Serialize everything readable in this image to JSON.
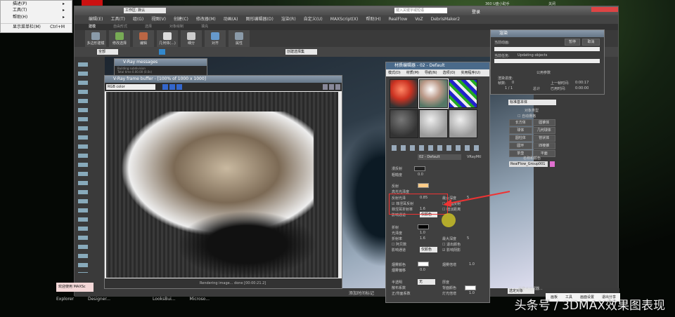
{
  "top": {
    "usb": "360 U盘小助手",
    "close": "关闭"
  },
  "context_menu": {
    "items": [
      {
        "label": "描述(P)"
      },
      {
        "label": "工具(T)"
      },
      {
        "label": "帮助(H)"
      },
      {
        "label": "显示菜单栏(M)",
        "shortcut": "Ctrl+M"
      }
    ]
  },
  "max": {
    "workspace": "工作区: 默认",
    "search_placeholder": "键入关键字或短语",
    "login": "登录",
    "menu": [
      "编辑(E)",
      "工具(T)",
      "组(G)",
      "视图(V)",
      "创建(C)",
      "修改器(M)",
      "动画(A)",
      "图形编辑器(D)",
      "渲染(R)",
      "自定义(U)",
      "MAXScript(X)",
      "帮助(H)",
      "RealFlow",
      "VoZ",
      "DebrisMaker2"
    ],
    "ribbon_tabs": [
      "建模",
      "自由形式",
      "选择",
      "对象绘制",
      "填充"
    ],
    "ribbon_buttons": [
      "多边形建模",
      "修改选择",
      "编辑",
      "几何体(...)",
      "细分",
      "对齐",
      "属性"
    ],
    "filter": "全部",
    "selection_set": "创建选择集"
  },
  "vray_messages": {
    "title": "V-Ray messages",
    "lines": [
      "Building subdivision",
      "Total time 0.00.00 (0.0s)"
    ]
  },
  "vfb": {
    "title": "V-Ray frame buffer - [100% of 1000 x 1000]",
    "channel": "RGB color",
    "status": "Rendering image... done [00:00:21.2]"
  },
  "mat_editor": {
    "title": "材质编辑器 - 02 - Default",
    "menu": [
      "模式(D)",
      "材质(M)",
      "导航(N)",
      "选项(O)",
      "实用程序(U)"
    ],
    "material_name": "02 - Default",
    "type": "VRayMtl",
    "params": {
      "diffuse": "漫反射",
      "roughness": "粗糙度",
      "roughness_val": "0.0",
      "reflect": "反射",
      "hilight": "高光光泽度",
      "refl_gloss": "反射光泽",
      "refl_gloss_val": "0.85",
      "fresnel": "菲涅耳反射",
      "fresnel_ior": "菲涅耳折射率",
      "fresnel_ior_val": "1.6",
      "affect": "影响通道",
      "affect_val": "仅颜色",
      "max_depth": "最大深度",
      "max_depth_val": "5",
      "back_refl": "背面反射",
      "dim_dist": "暗淡距离",
      "refract": "折射",
      "gloss": "光泽度",
      "gloss_val": "1.0",
      "ior": "折射率",
      "ior_val": "1.6",
      "abbe": "阿贝数",
      "affect2": "影响通道",
      "affect2_val": "仅颜色",
      "max_depth2": "最大深度",
      "max_depth2_val": "5",
      "exit_color": "退出颜色",
      "affect_shadows": "影响阴影",
      "fog_color": "烟雾颜色",
      "fog_mult": "烟雾倍增",
      "fog_mult_val": "1.0",
      "fog_bias": "烟雾偏移",
      "fog_bias_val": "0.0",
      "translucency": "半透明",
      "translucency_val": "无",
      "scatter": "散布系数",
      "fwd_bck": "正/背面系数",
      "thickness": "厚度",
      "back_color": "背面颜色",
      "light_mult": "灯光倍增",
      "light_mult_val": "1.0"
    }
  },
  "render_dialog": {
    "title": "渲染",
    "current_anim": "当前动画:",
    "pause": "暂停",
    "cancel": "取消",
    "current_task": "当前任务:",
    "task": "Updating objects",
    "common": "公用参数",
    "progress": "渲染进度:",
    "frames_label": "帧数:",
    "frames": "0",
    "count": "1 / 1",
    "total": "总计",
    "last_frame": "上一帧时间:",
    "last_frame_val": "0:00:17",
    "elapsed": "已用时间:",
    "elapsed_val": "0:00:00"
  },
  "command_panel": {
    "category": "标准基本体",
    "object_type": "对象类型",
    "autogrid": "自动栅格",
    "buttons": [
      "长方体",
      "圆锥体",
      "球体",
      "几何球体",
      "圆柱体",
      "管状体",
      "圆环",
      "四棱锥",
      "茶壶",
      "平面"
    ],
    "name_color": "名称和颜色",
    "name": "RealFlow_Group001",
    "color": "#e070d0"
  },
  "status": {
    "welcome": "欢迎使用 MAXSc",
    "selected": "选定对象",
    "key_filter": "关键点过滤器...",
    "add_tag": "添加时间标记"
  },
  "taskbar": [
    "Explorer",
    "Designer...",
    "LooksBui...",
    "Microso..."
  ],
  "share_bar": [
    "画板",
    "工具",
    "画面设置",
    "退出分享"
  ],
  "watermark": "头条号 / 3DMAX效果图表现"
}
